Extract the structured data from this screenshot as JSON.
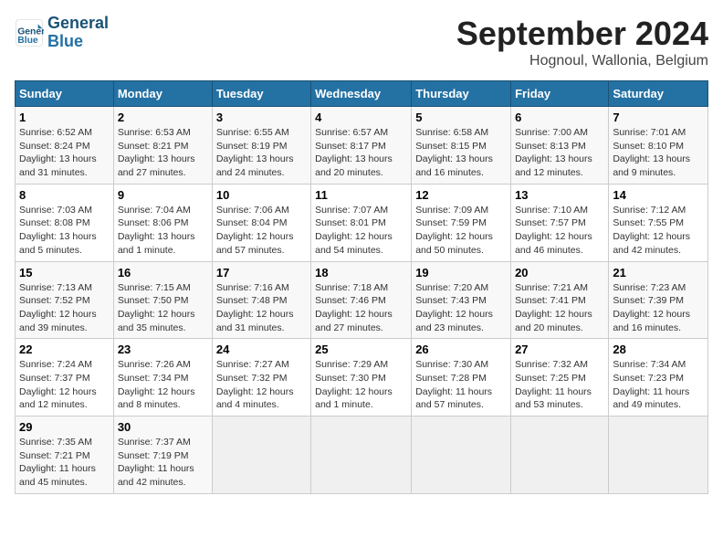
{
  "logo": {
    "text_general": "General",
    "text_blue": "Blue"
  },
  "title": "September 2024",
  "subtitle": "Hognoul, Wallonia, Belgium",
  "days_of_week": [
    "Sunday",
    "Monday",
    "Tuesday",
    "Wednesday",
    "Thursday",
    "Friday",
    "Saturday"
  ],
  "weeks": [
    [
      {
        "day": "1",
        "detail": "Sunrise: 6:52 AM\nSunset: 8:24 PM\nDaylight: 13 hours\nand 31 minutes."
      },
      {
        "day": "2",
        "detail": "Sunrise: 6:53 AM\nSunset: 8:21 PM\nDaylight: 13 hours\nand 27 minutes."
      },
      {
        "day": "3",
        "detail": "Sunrise: 6:55 AM\nSunset: 8:19 PM\nDaylight: 13 hours\nand 24 minutes."
      },
      {
        "day": "4",
        "detail": "Sunrise: 6:57 AM\nSunset: 8:17 PM\nDaylight: 13 hours\nand 20 minutes."
      },
      {
        "day": "5",
        "detail": "Sunrise: 6:58 AM\nSunset: 8:15 PM\nDaylight: 13 hours\nand 16 minutes."
      },
      {
        "day": "6",
        "detail": "Sunrise: 7:00 AM\nSunset: 8:13 PM\nDaylight: 13 hours\nand 12 minutes."
      },
      {
        "day": "7",
        "detail": "Sunrise: 7:01 AM\nSunset: 8:10 PM\nDaylight: 13 hours\nand 9 minutes."
      }
    ],
    [
      {
        "day": "8",
        "detail": "Sunrise: 7:03 AM\nSunset: 8:08 PM\nDaylight: 13 hours\nand 5 minutes."
      },
      {
        "day": "9",
        "detail": "Sunrise: 7:04 AM\nSunset: 8:06 PM\nDaylight: 13 hours\nand 1 minute."
      },
      {
        "day": "10",
        "detail": "Sunrise: 7:06 AM\nSunset: 8:04 PM\nDaylight: 12 hours\nand 57 minutes."
      },
      {
        "day": "11",
        "detail": "Sunrise: 7:07 AM\nSunset: 8:01 PM\nDaylight: 12 hours\nand 54 minutes."
      },
      {
        "day": "12",
        "detail": "Sunrise: 7:09 AM\nSunset: 7:59 PM\nDaylight: 12 hours\nand 50 minutes."
      },
      {
        "day": "13",
        "detail": "Sunrise: 7:10 AM\nSunset: 7:57 PM\nDaylight: 12 hours\nand 46 minutes."
      },
      {
        "day": "14",
        "detail": "Sunrise: 7:12 AM\nSunset: 7:55 PM\nDaylight: 12 hours\nand 42 minutes."
      }
    ],
    [
      {
        "day": "15",
        "detail": "Sunrise: 7:13 AM\nSunset: 7:52 PM\nDaylight: 12 hours\nand 39 minutes."
      },
      {
        "day": "16",
        "detail": "Sunrise: 7:15 AM\nSunset: 7:50 PM\nDaylight: 12 hours\nand 35 minutes."
      },
      {
        "day": "17",
        "detail": "Sunrise: 7:16 AM\nSunset: 7:48 PM\nDaylight: 12 hours\nand 31 minutes."
      },
      {
        "day": "18",
        "detail": "Sunrise: 7:18 AM\nSunset: 7:46 PM\nDaylight: 12 hours\nand 27 minutes."
      },
      {
        "day": "19",
        "detail": "Sunrise: 7:20 AM\nSunset: 7:43 PM\nDaylight: 12 hours\nand 23 minutes."
      },
      {
        "day": "20",
        "detail": "Sunrise: 7:21 AM\nSunset: 7:41 PM\nDaylight: 12 hours\nand 20 minutes."
      },
      {
        "day": "21",
        "detail": "Sunrise: 7:23 AM\nSunset: 7:39 PM\nDaylight: 12 hours\nand 16 minutes."
      }
    ],
    [
      {
        "day": "22",
        "detail": "Sunrise: 7:24 AM\nSunset: 7:37 PM\nDaylight: 12 hours\nand 12 minutes."
      },
      {
        "day": "23",
        "detail": "Sunrise: 7:26 AM\nSunset: 7:34 PM\nDaylight: 12 hours\nand 8 minutes."
      },
      {
        "day": "24",
        "detail": "Sunrise: 7:27 AM\nSunset: 7:32 PM\nDaylight: 12 hours\nand 4 minutes."
      },
      {
        "day": "25",
        "detail": "Sunrise: 7:29 AM\nSunset: 7:30 PM\nDaylight: 12 hours\nand 1 minute."
      },
      {
        "day": "26",
        "detail": "Sunrise: 7:30 AM\nSunset: 7:28 PM\nDaylight: 11 hours\nand 57 minutes."
      },
      {
        "day": "27",
        "detail": "Sunrise: 7:32 AM\nSunset: 7:25 PM\nDaylight: 11 hours\nand 53 minutes."
      },
      {
        "day": "28",
        "detail": "Sunrise: 7:34 AM\nSunset: 7:23 PM\nDaylight: 11 hours\nand 49 minutes."
      }
    ],
    [
      {
        "day": "29",
        "detail": "Sunrise: 7:35 AM\nSunset: 7:21 PM\nDaylight: 11 hours\nand 45 minutes."
      },
      {
        "day": "30",
        "detail": "Sunrise: 7:37 AM\nSunset: 7:19 PM\nDaylight: 11 hours\nand 42 minutes."
      },
      {
        "day": "",
        "detail": ""
      },
      {
        "day": "",
        "detail": ""
      },
      {
        "day": "",
        "detail": ""
      },
      {
        "day": "",
        "detail": ""
      },
      {
        "day": "",
        "detail": ""
      }
    ]
  ]
}
